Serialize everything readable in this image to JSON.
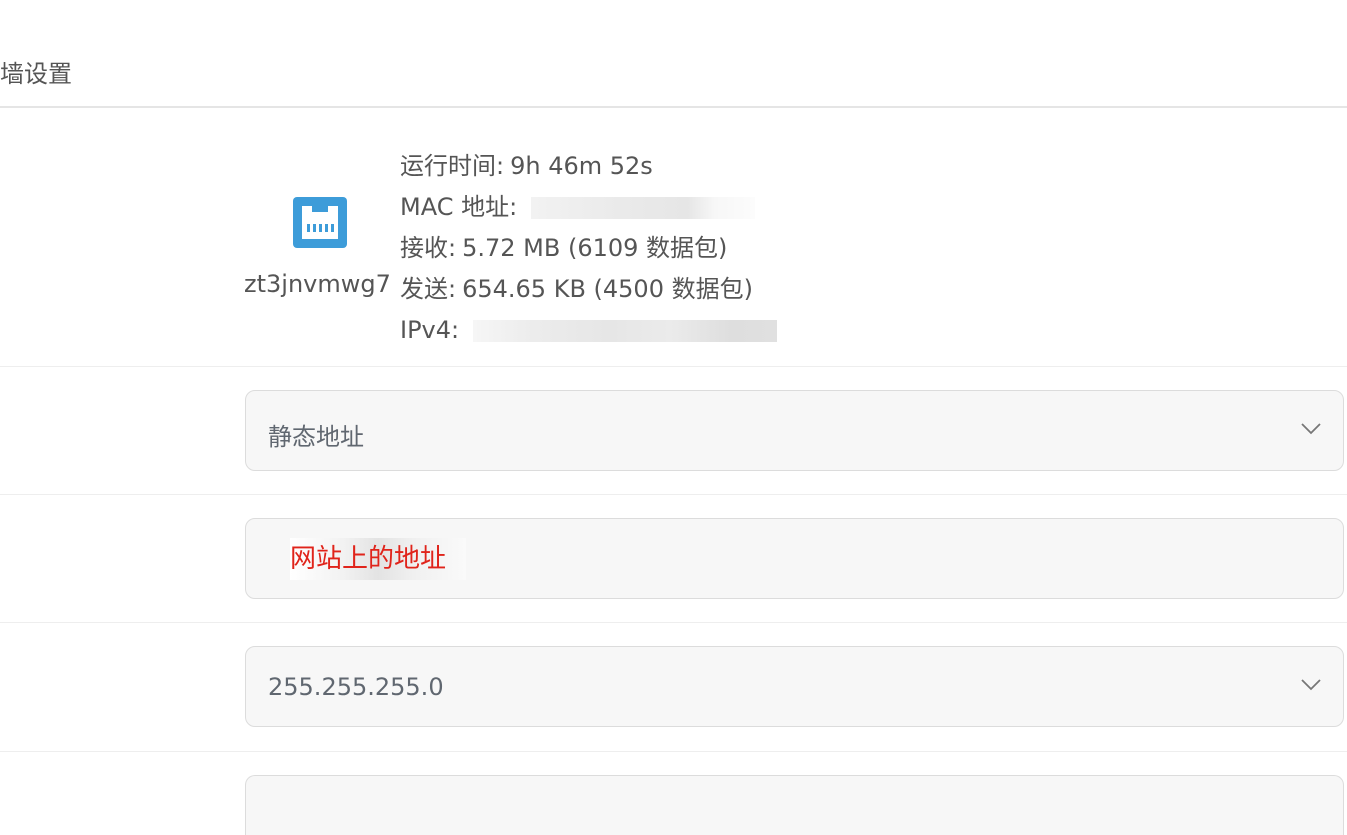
{
  "header": {
    "tab_title": "墙设置"
  },
  "interface": {
    "name": "zt3jnvmwg7",
    "icon": "ethernet-port-icon",
    "uptime_label": "运行时间:",
    "uptime_value": "9h 46m 52s",
    "mac_label": "MAC 地址:",
    "rx_label": "接收:",
    "rx_value": "5.72 MB (6109 数据包)",
    "tx_label": "发送:",
    "tx_value": "654.65 KB (4500 数据包)",
    "ipv4_label": "IPv4:"
  },
  "form": {
    "protocol": {
      "value": "静态地址"
    },
    "ipv4_address": {
      "value": "网站上的地址"
    },
    "netmask": {
      "value": "255.255.255.0"
    },
    "gateway": {
      "value": ""
    }
  },
  "colors": {
    "icon_blue": "#3d9cd9",
    "warning_red": "#e0241b"
  }
}
